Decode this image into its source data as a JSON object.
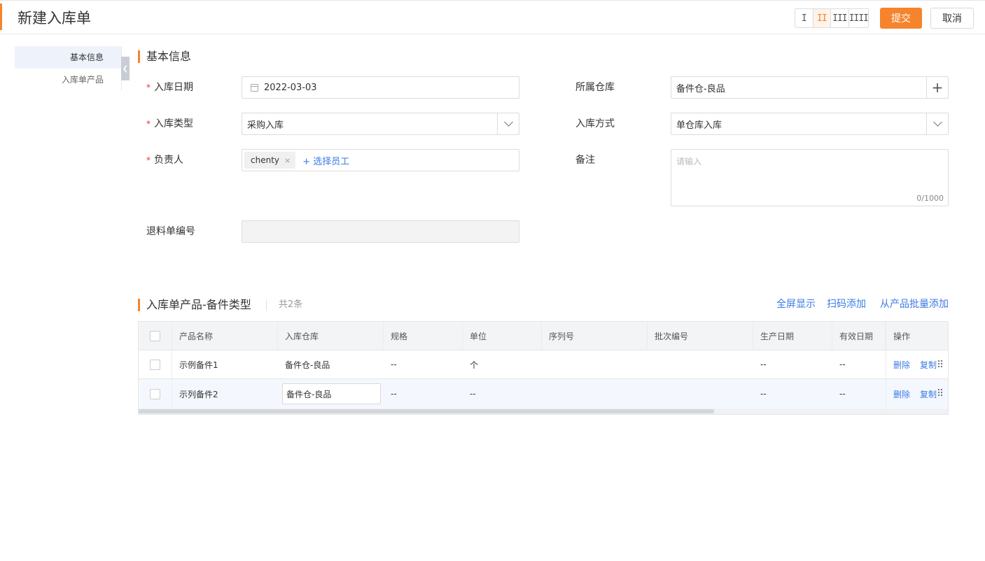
{
  "header": {
    "title": "新建入库单",
    "layout_options": [
      "I",
      "II",
      "III",
      "IIII"
    ],
    "active_layout_index": 1,
    "submit_label": "提交",
    "cancel_label": "取消"
  },
  "sidenav": {
    "items": [
      {
        "label": "基本信息",
        "active": true
      },
      {
        "label": "入库单产品",
        "active": false
      }
    ]
  },
  "basic": {
    "section_title": "基本信息",
    "inbound_date": {
      "label": "入库日期",
      "required": true,
      "value": "2022-03-03"
    },
    "warehouse": {
      "label": "所属仓库",
      "value": "备件仓-良品"
    },
    "inbound_type": {
      "label": "入库类型",
      "required": true,
      "value": "采购入库"
    },
    "inbound_method": {
      "label": "入库方式",
      "value": "单仓库入库"
    },
    "owner": {
      "label": "负责人",
      "required": true,
      "tag": "chenty",
      "add_label": "+ 选择员工"
    },
    "remark": {
      "label": "备注",
      "placeholder": "请输入",
      "counter": "0/1000"
    },
    "return_no": {
      "label": "退料单编号",
      "value": ""
    }
  },
  "products": {
    "section_title": "入库单产品-备件类型",
    "count_text": "共2条",
    "actions": [
      "全屏显示",
      "扫码添加",
      "从产品批量添加"
    ],
    "columns": [
      "产品名称",
      "入库仓库",
      "规格",
      "单位",
      "序列号",
      "批次编号",
      "生产日期",
      "有效日期",
      "操作"
    ],
    "rows": [
      {
        "name": "示例备件1",
        "warehouse": "备件仓-良品",
        "spec": "--",
        "unit": "个",
        "serial": "",
        "batch": "",
        "mfg_date": "--",
        "exp_date": "--",
        "op_delete": "删除",
        "op_copy": "复制"
      },
      {
        "name": "示列备件2",
        "warehouse": "备件仓-良品",
        "spec": "--",
        "unit": "--",
        "serial": "",
        "batch": "",
        "mfg_date": "--",
        "exp_date": "--",
        "op_delete": "删除",
        "op_copy": "复制"
      }
    ]
  }
}
